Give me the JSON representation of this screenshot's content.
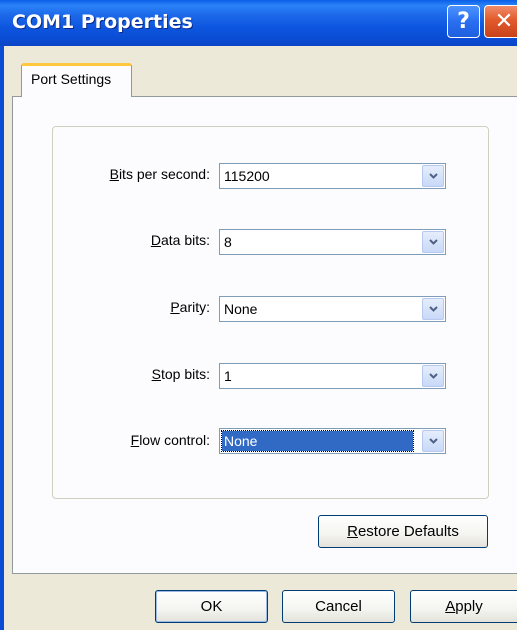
{
  "window": {
    "title": "COM1 Properties",
    "help_glyph": "?",
    "close_glyph": "✕"
  },
  "tabs": [
    {
      "label": "Port Settings",
      "selected": true
    }
  ],
  "fields": [
    {
      "label_hotkey": "B",
      "label_rest": "its per second:",
      "value": "115200"
    },
    {
      "label_hotkey": "D",
      "label_rest": "ata bits:",
      "value": "8"
    },
    {
      "label_hotkey": "P",
      "label_rest": "arity:",
      "value": "None"
    },
    {
      "label_hotkey": "S",
      "label_rest": "top bits:",
      "value": "1"
    },
    {
      "label_hotkey": "F",
      "label_rest": "low control:",
      "value": "None"
    }
  ],
  "restore_button": {
    "hotkey": "R",
    "rest": "estore Defaults"
  },
  "dialog_buttons": {
    "ok": "OK",
    "cancel": "Cancel",
    "apply_hotkey": "A",
    "apply_rest": "pply"
  },
  "colors": {
    "titlebar": "#0A4CD4",
    "selection": "#316AC5",
    "dialog_bg": "#ECE9D8"
  }
}
